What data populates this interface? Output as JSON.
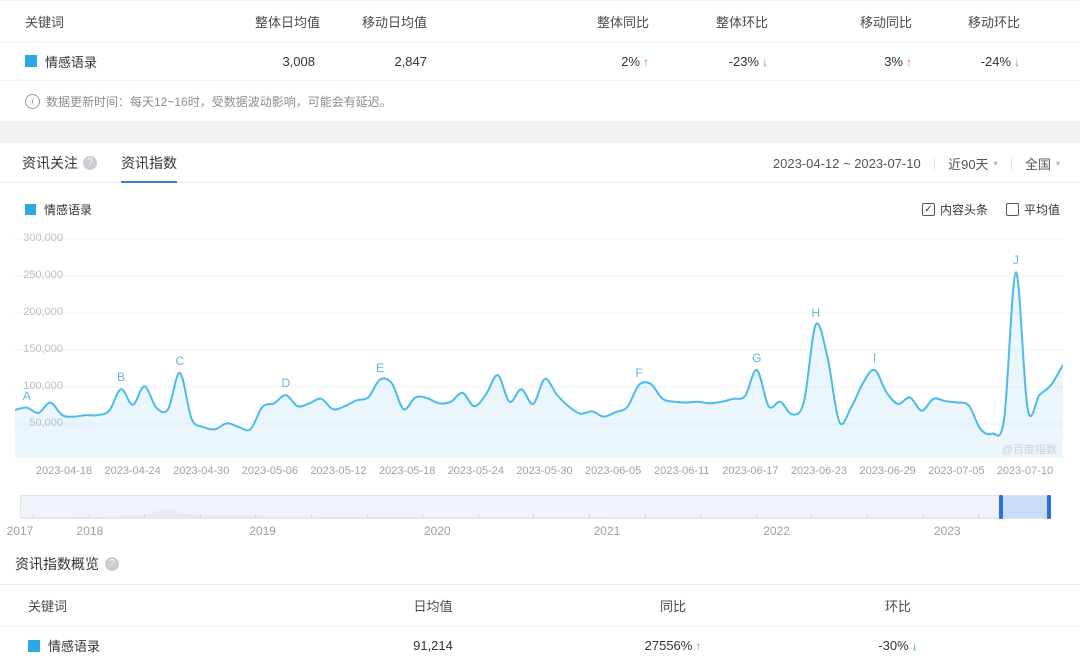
{
  "colors": {
    "keyword_swatch": "#29abe2",
    "line": "#4cbbe8",
    "up_red": "#f0604d",
    "down_green": "#2eb358",
    "tab_underline": "#3f7ae0",
    "slider_handle": "#2e6fe0",
    "slider_selection": "#c9ddf8"
  },
  "stats_table": {
    "headers": [
      "关键词",
      "整体日均值",
      "移动日均值",
      "整体同比",
      "整体环比",
      "移动同比",
      "移动环比"
    ],
    "row": {
      "keyword": "情感语录",
      "values": [
        "3,008",
        "2,847"
      ],
      "trends": [
        {
          "text": "2%",
          "dir": "up"
        },
        {
          "text": "-23%",
          "dir": "down"
        },
        {
          "text": "3%",
          "dir": "up"
        },
        {
          "text": "-24%",
          "dir": "down"
        }
      ]
    }
  },
  "update_note": "数据更新时间：每天12~16时，受数据波动影响，可能会有延迟。",
  "chart_section": {
    "tabs": [
      {
        "label": "资讯关注",
        "active": false,
        "has_help": true
      },
      {
        "label": "资讯指数",
        "active": true,
        "has_help": false
      }
    ],
    "date_range": "2023-04-12 ~ 2023-07-10",
    "period_filter": "近90天",
    "region_filter": "全国",
    "legend_keyword": "情感语录",
    "checkboxes": [
      {
        "label": "内容头条",
        "checked": true
      },
      {
        "label": "平均值",
        "checked": false
      }
    ],
    "watermark": "@百度指数"
  },
  "chart_data": {
    "type": "line",
    "title": "资讯指数",
    "x_start": "2023-04-12",
    "x_end": "2023-07-10",
    "x_tick_labels": [
      "2023-04-18",
      "2023-04-24",
      "2023-04-30",
      "2023-05-06",
      "2023-05-12",
      "2023-05-18",
      "2023-05-24",
      "2023-05-30",
      "2023-06-05",
      "2023-06-11",
      "2023-06-17",
      "2023-06-23",
      "2023-06-29",
      "2023-07-05",
      "2023-07-10"
    ],
    "y_ticks": [
      "300,000",
      "250,000",
      "200,000",
      "150,000",
      "100,000",
      "50,000"
    ],
    "ylim": [
      0,
      300000
    ],
    "grid": "horizontal",
    "legend_position": "top-left",
    "series": [
      {
        "name": "情感语录",
        "color": "#4cbbe8",
        "values": [
          69000,
          72000,
          65000,
          79000,
          62000,
          60000,
          62000,
          62000,
          68000,
          97000,
          76000,
          101000,
          72000,
          70000,
          119000,
          57000,
          46000,
          43000,
          51000,
          46000,
          43000,
          73000,
          78000,
          89000,
          74000,
          78000,
          84000,
          70000,
          74000,
          82000,
          86000,
          110000,
          105000,
          70000,
          86000,
          85000,
          78000,
          80000,
          92000,
          74000,
          90000,
          116000,
          80000,
          97000,
          77000,
          111000,
          90000,
          74000,
          64000,
          67000,
          60000,
          66000,
          73000,
          103000,
          104000,
          84000,
          80000,
          79000,
          80000,
          78000,
          80000,
          84000,
          88000,
          123000,
          74000,
          80000,
          63000,
          80000,
          184000,
          140000,
          53000,
          72000,
          105000,
          123000,
          93000,
          77000,
          86000,
          68000,
          84000,
          81000,
          79000,
          75000,
          43000,
          37000,
          57000,
          255000,
          70000,
          89000,
          103000,
          130000
        ]
      }
    ],
    "annotations": [
      {
        "label": "A",
        "index": 1
      },
      {
        "label": "B",
        "index": 9
      },
      {
        "label": "C",
        "index": 14
      },
      {
        "label": "D",
        "index": 23
      },
      {
        "label": "E",
        "index": 31
      },
      {
        "label": "F",
        "index": 53
      },
      {
        "label": "G",
        "index": 63
      },
      {
        "label": "H",
        "index": 68
      },
      {
        "label": "I",
        "index": 73
      },
      {
        "label": "J",
        "index": 85
      }
    ]
  },
  "timeline": {
    "years": [
      {
        "label": "2017",
        "x_frac": 0.0
      },
      {
        "label": "2018",
        "x_frac": 0.068
      },
      {
        "label": "2019",
        "x_frac": 0.236
      },
      {
        "label": "2020",
        "x_frac": 0.406
      },
      {
        "label": "2021",
        "x_frac": 0.571
      },
      {
        "label": "2022",
        "x_frac": 0.736
      },
      {
        "label": "2023",
        "x_frac": 0.902
      }
    ],
    "selection": {
      "start_frac": 0.954,
      "end_frac": 0.999
    }
  },
  "overview_table": {
    "title": "资讯指数概览",
    "headers": [
      "关键词",
      "日均值",
      "同比",
      "环比"
    ],
    "row": {
      "keyword": "情感语录",
      "avg": "91,214",
      "yoy": {
        "text": "27556%",
        "dir": "up"
      },
      "mom": {
        "text": "-30%",
        "dir": "down"
      }
    }
  }
}
